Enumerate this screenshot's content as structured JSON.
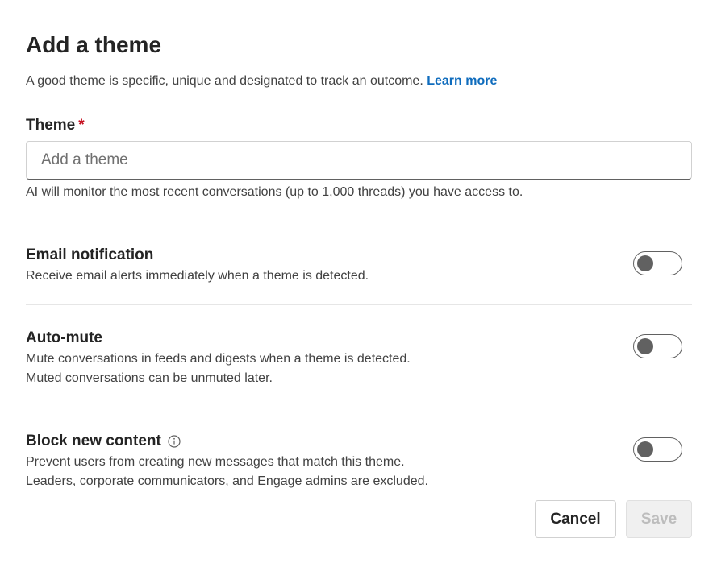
{
  "dialog": {
    "title": "Add a theme",
    "subtitle": "A good theme is specific, unique and designated to track an outcome.",
    "learn_more": "Learn more"
  },
  "theme_field": {
    "label": "Theme",
    "required_mark": "*",
    "value": "",
    "placeholder": "Add a theme",
    "hint": "AI will monitor the most recent conversations (up to 1,000 threads) you have access to."
  },
  "settings": {
    "email": {
      "title": "Email notification",
      "desc_line1": "Receive email alerts immediately when a theme is detected.",
      "enabled": false
    },
    "automute": {
      "title": "Auto-mute",
      "desc_line1": "Mute conversations in feeds and digests when a theme is detected.",
      "desc_line2": "Muted conversations can be unmuted later.",
      "enabled": false
    },
    "block": {
      "title": "Block new content",
      "info_icon": "info-icon",
      "desc_line1": "Prevent users from creating new messages that match this theme.",
      "desc_line2": "Leaders, corporate communicators, and Engage admins are excluded.",
      "enabled": false
    }
  },
  "actions": {
    "cancel_label": "Cancel",
    "save_label": "Save",
    "save_disabled": true
  },
  "colors": {
    "link": "#0f6cbd",
    "required": "#c50f1f",
    "toggle_off": "#616161",
    "text_primary": "#242424",
    "text_secondary": "#424242"
  }
}
